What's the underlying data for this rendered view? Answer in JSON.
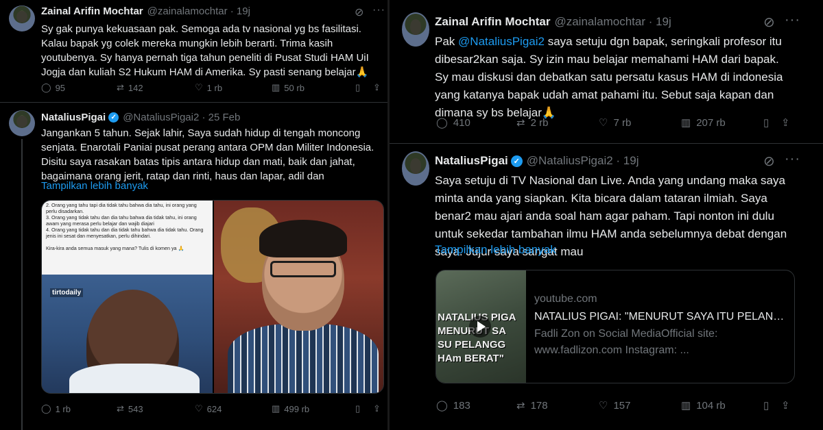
{
  "left": {
    "tweet1": {
      "name": "Zainal Arifin Mochtar",
      "handle": "@zainalamochtar · 19j",
      "text": "Sy gak punya kekuasaan pak. Semoga ada tv nasional yg bs fasilitasi. Kalau bapak yg colek mereka mungkin lebih berarti. Trima kasih youtubenya. Sy hanya pernah tiga tahun peneliti di Pusat Studi HAM UiI Jogja dan kuliah S2 Hukum HAM di Amerika. Sy pasti senang belajar🙏",
      "replies": "95",
      "reposts": "142",
      "likes": "1 rb",
      "views": "50 rb"
    },
    "tweet2": {
      "name": "NataliusPigai",
      "handle": "@NataliusPigai2 · 25 Feb",
      "text": "Jangankan 5 tahun. Sejak lahir, Saya sudah hidup di tengah moncong senjata. Enarotali Paniai pusat perang antara OPM dan Militer Indonesia. Disitu saya rasakan  batas tipis antara hidup dan mati, baik dan jahat, bagaimana orang  jerit, ratap dan rinti, haus dan lapar, adil dan",
      "show_more": "Tampilkan lebih banyak",
      "media_note": "2. Orang yang tahu tapi dia tidak tahu bahwa dia tahu, ini orang yang perlu disadarkan.\n3. Orang yang tidak tahu dan dia tahu bahwa dia tidak tahu, ini orang awam yang merasa perlu belajar dan wajib diajari\n4. Orang yang tidak tahu dan dia tidak tahu bahwa dia tidak tahu. Orang jenis ini sesat dan menyesatkan, perlu dihindari.\n\nKira-kira anda semua masuk yang mana? Tulis di komen ya 🙏",
      "media_logo": "tirtodaily",
      "replies": "1 rb",
      "reposts": "543",
      "likes": "624",
      "views": "499 rb"
    }
  },
  "right": {
    "tweet1": {
      "name": "Zainal Arifin Mochtar",
      "handle": "@zainalamochtar · 19j",
      "mention": "@NataliusPigai2",
      "text_before": "Pak ",
      "text_after": " saya setuju dgn bapak, seringkali profesor itu dibesar2kan saja. Sy izin mau belajar memahami HAM dari bapak. Sy mau diskusi dan debatkan satu persatu kasus HAM di indonesia yang katanya bapak udah amat pahami itu. Sebut saja kapan dan dimana sy bs belajar🙏",
      "replies": "410",
      "reposts": "2 rb",
      "likes": "7 rb",
      "views": "207 rb"
    },
    "tweet2": {
      "name": "NataliusPigai",
      "handle": "@NataliusPigai2 · 19j",
      "text": "Saya setuju di TV Nasional dan Live. Anda yang undang maka saya minta anda yang siapkan. Kita bicara dalam tataran ilmiah. Saya benar2 mau ajari anda soal ham agar paham. Tapi nonton ini dulu untuk sekedar tambahan ilmu HAM anda sebelumnya debat dengan saya. Jujur saya sangat mau",
      "show_more": "Tampilkan lebih banyak",
      "card": {
        "domain": "youtube.com",
        "title": "NATALIUS PIGAI: \"MENURUT SAYA ITU PELANGGA...",
        "desc": "Fadli Zon on Social MediaOfficial site: www.fadlizon.com Instagram: ...",
        "thumb_lines": [
          "NATALIUS PIGA",
          "MENURUT SA",
          "SU PELANGG",
          "HAm BERAT\""
        ]
      },
      "replies": "183",
      "reposts": "178",
      "likes": "157",
      "views": "104 rb"
    }
  },
  "colors": {
    "accent": "#1d9bf0",
    "muted": "#71767b",
    "text": "#e7e9ea",
    "bg": "#000000"
  }
}
